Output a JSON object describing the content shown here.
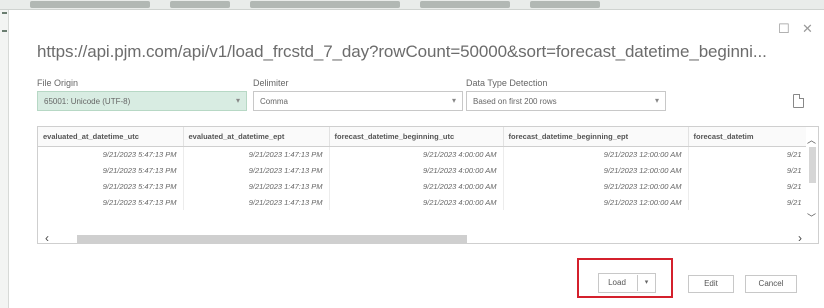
{
  "window": {
    "maximize_glyph": "☐",
    "close_glyph": "✕"
  },
  "title": "https://api.pjm.com/api/v1/load_frcstd_7_day?rowCount=50000&sort=forecast_datetime_beginni...",
  "options": {
    "file_origin": {
      "label": "File Origin",
      "value": "65001: Unicode (UTF-8)"
    },
    "delimiter": {
      "label": "Delimiter",
      "value": "Comma"
    },
    "detection": {
      "label": "Data Type Detection",
      "value": "Based on first 200 rows"
    }
  },
  "table": {
    "columns": [
      "evaluated_at_datetime_utc",
      "evaluated_at_datetime_ept",
      "forecast_datetime_beginning_utc",
      "forecast_datetime_beginning_ept",
      "forecast_datetim"
    ],
    "rows": [
      [
        "9/21/2023 5:47:13 PM",
        "9/21/2023 1:47:13 PM",
        "9/21/2023 4:00:00 AM",
        "9/21/2023 12:00:00 AM",
        "9/21"
      ],
      [
        "9/21/2023 5:47:13 PM",
        "9/21/2023 1:47:13 PM",
        "9/21/2023 4:00:00 AM",
        "9/21/2023 12:00:00 AM",
        "9/21"
      ],
      [
        "9/21/2023 5:47:13 PM",
        "9/21/2023 1:47:13 PM",
        "9/21/2023 4:00:00 AM",
        "9/21/2023 12:00:00 AM",
        "9/21"
      ],
      [
        "9/21/2023 5:47:13 PM",
        "9/21/2023 1:47:13 PM",
        "9/21/2023 4:00:00 AM",
        "9/21/2023 12:00:00 AM",
        "9/21"
      ]
    ]
  },
  "buttons": {
    "load": "Load",
    "load_dropdown_glyph": "▾",
    "edit": "Edit",
    "cancel": "Cancel"
  },
  "highlight_color": "#d4202c"
}
